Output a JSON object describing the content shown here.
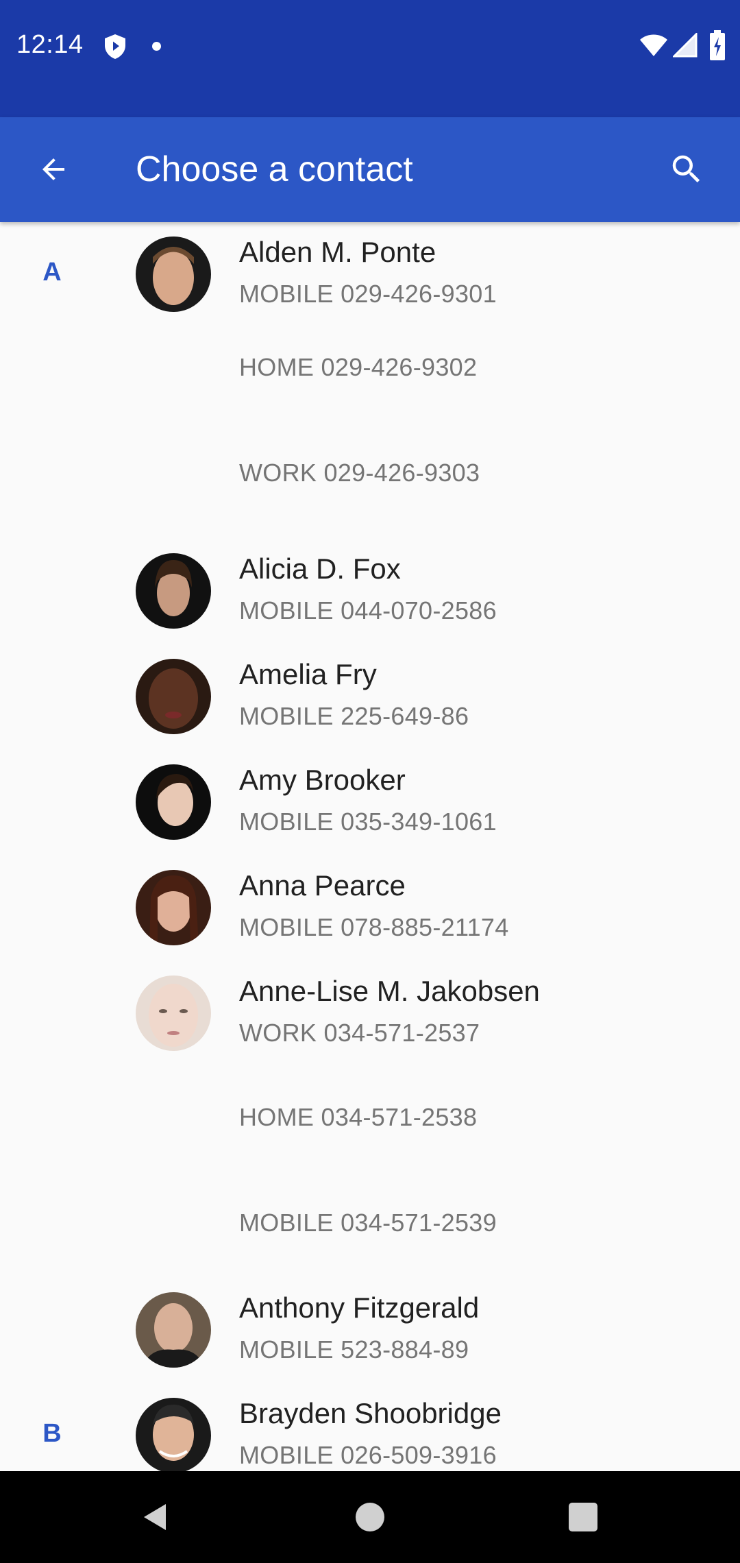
{
  "status": {
    "time": "12:14"
  },
  "app_bar": {
    "title": "Choose a contact"
  },
  "icons": {
    "back": "arrow-back-icon",
    "search": "search-icon",
    "shield": "shield-icon",
    "wifi": "wifi-icon",
    "cell": "cell-signal-icon",
    "battery": "battery-icon"
  },
  "colors": {
    "status_bar": "#1b3aa8",
    "app_bar": "#2c57c6",
    "section_letter": "#2c57c6",
    "background": "#fafafa"
  },
  "sections": [
    "A",
    "B"
  ],
  "contacts": [
    {
      "name": "Alden M. Ponte",
      "phones": [
        "MOBILE 029-426-9301",
        "HOME 029-426-9302",
        "WORK 029-426-9303"
      ]
    },
    {
      "name": "Alicia D. Fox",
      "phones": [
        "MOBILE 044-070-2586"
      ]
    },
    {
      "name": "Amelia Fry",
      "phones": [
        "MOBILE 225-649-86"
      ]
    },
    {
      "name": "Amy Brooker",
      "phones": [
        "MOBILE 035-349-1061"
      ]
    },
    {
      "name": "Anna Pearce",
      "phones": [
        "MOBILE 078-885-21174"
      ]
    },
    {
      "name": "Anne-Lise M. Jakobsen",
      "phones": [
        "WORK 034-571-2537",
        "HOME 034-571-2538",
        "MOBILE 034-571-2539"
      ]
    },
    {
      "name": "Anthony Fitzgerald",
      "phones": [
        "MOBILE 523-884-89"
      ]
    },
    {
      "name": "Brayden Shoobridge",
      "phones": [
        "MOBILE 026-509-3916"
      ]
    }
  ]
}
